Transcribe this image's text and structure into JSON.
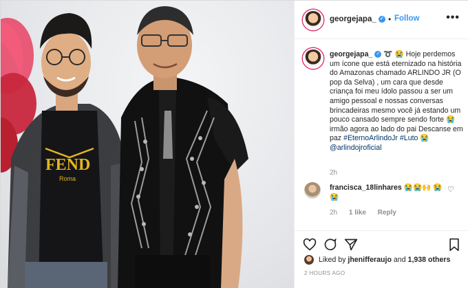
{
  "post": {
    "username": "georgejapa_",
    "follow_label": "Follow",
    "more_label": "•••",
    "verified_mark": "✓"
  },
  "caption": {
    "username": "georgejapa_",
    "text_intro": "➰ 😭 Hoje perdemos um ícone que está eternizado na história do Amazonas chamado ARLINDO JR (O pop da Selva) , um cara que desde criança foi meu ídolo passou a ser um amigo pessoal e nossas conversas brincadeiras mesmo você já estando um pouco cansado sempre sendo forte 😭 irmão agora ao lado do pai Descanse em paz",
    "hashtag_1": "#EternoArlindoJr",
    "hashtag_2": "#Luto",
    "emoji_between": "😭",
    "mention": "@arlindojroficial",
    "time": "2h"
  },
  "comment": {
    "username": "francisca_18linhares",
    "text": "😭😭🙌 😭😭",
    "time": "2h",
    "likes": "1 like",
    "reply": "Reply"
  },
  "likes": {
    "prefix": "Liked by",
    "user": "jhenifferaujo",
    "conj": "and",
    "others": "1,938 others"
  },
  "posted_ago": "2 HOURS AGO",
  "icons": [
    "heart-icon",
    "comment-icon",
    "share-icon",
    "bookmark-icon"
  ],
  "colors": {
    "link": "#3897f0",
    "hashtag": "#003569",
    "muted": "#8e8e8e"
  }
}
